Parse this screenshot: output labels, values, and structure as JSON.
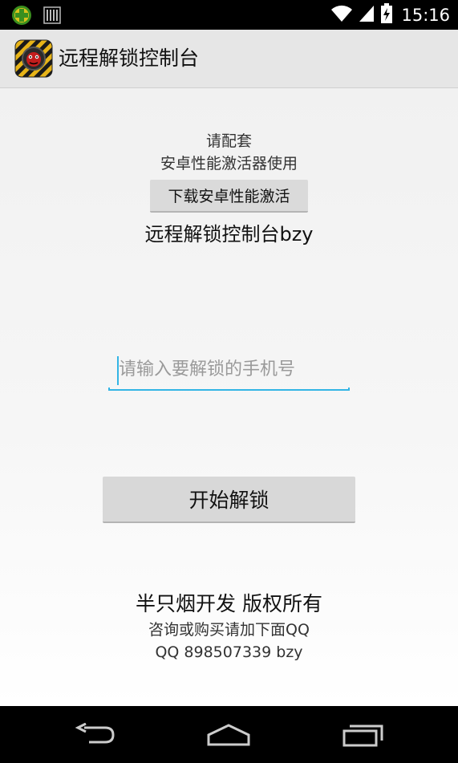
{
  "status_bar": {
    "time": "15:16",
    "icons": [
      "app-notification-icon",
      "barcode-notification-icon",
      "wifi-icon",
      "cell-signal-icon",
      "battery-icon"
    ]
  },
  "action_bar": {
    "title": "远程解锁控制台",
    "icon": "app-logo-icon"
  },
  "main": {
    "hint_line1": "请配套",
    "hint_line2": "安卓性能激活器使用",
    "download_button": "下载安卓性能激活",
    "subtitle": "远程解锁控制台bzy",
    "phone_input": {
      "value": "",
      "placeholder": "请输入要解锁的手机号"
    },
    "start_button": "开始解锁",
    "copyright": "半只烟开发 版权所有",
    "consult_text": "咨询或购买请加下面QQ",
    "qq_text": "QQ 898507339 bzy"
  },
  "nav_bar": {
    "buttons": [
      "back-icon",
      "home-icon",
      "recent-apps-icon"
    ]
  },
  "colors": {
    "accent": "#33b5e5",
    "action_bar": "#e6e6e6",
    "button": "#d8d8d8"
  }
}
